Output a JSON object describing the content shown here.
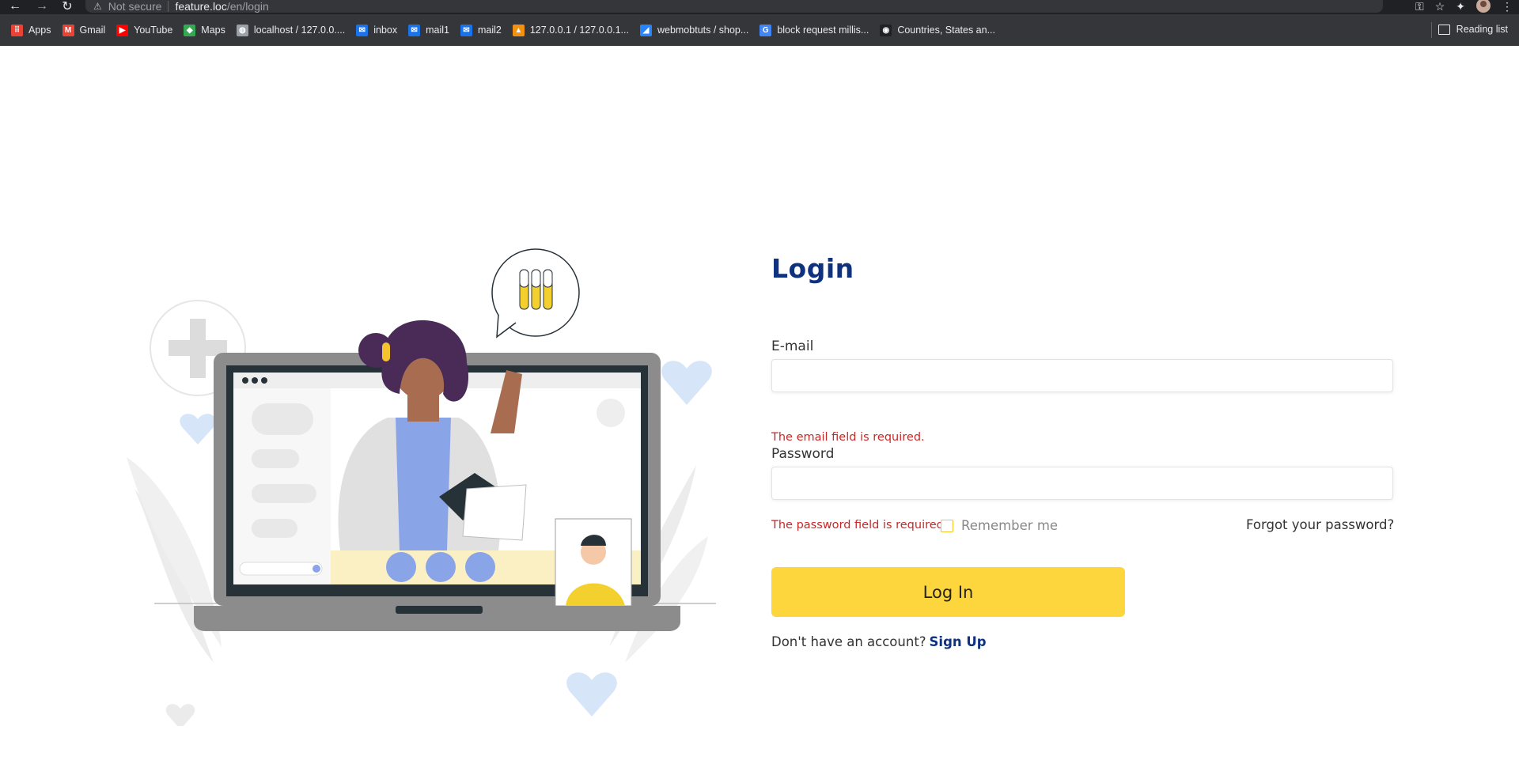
{
  "browser": {
    "omnibox": {
      "security_text": "Not secure",
      "host": "feature.loc",
      "path": "/en/login"
    },
    "bookmarks": [
      {
        "label": "Apps",
        "icon": "apps-grid-icon",
        "color": "#ea4335"
      },
      {
        "label": "Gmail",
        "icon": "gmail-icon",
        "color": "#ea4335"
      },
      {
        "label": "YouTube",
        "icon": "youtube-icon",
        "color": "#ff0000"
      },
      {
        "label": "Maps",
        "icon": "maps-icon",
        "color": "#34a853"
      },
      {
        "label": "localhost / 127.0.0....",
        "icon": "globe-icon",
        "color": "#9aa0a6"
      },
      {
        "label": "inbox",
        "icon": "mail-icon",
        "color": "#1a73e8"
      },
      {
        "label": "mail1",
        "icon": "mail-icon",
        "color": "#1a73e8"
      },
      {
        "label": "mail2",
        "icon": "mail-icon",
        "color": "#1a73e8"
      },
      {
        "label": "127.0.0.1 / 127.0.0.1...",
        "icon": "phpmyadmin-icon",
        "color": "#f29111"
      },
      {
        "label": "webmobtuts / shop...",
        "icon": "bitbucket-icon",
        "color": "#2684ff"
      },
      {
        "label": "block request millis...",
        "icon": "google-icon",
        "color": "#4285f4"
      },
      {
        "label": "Countries, States an...",
        "icon": "site-icon",
        "color": "#202124"
      }
    ],
    "reading_list": "Reading list"
  },
  "login": {
    "title": "Login",
    "email_label": "E-mail",
    "email_value": "",
    "email_error": "The email field is required.",
    "password_label": "Password",
    "password_value": "",
    "password_error": "The password field is required.",
    "remember_label": "Remember me",
    "forgot_label": "Forgot your password?",
    "submit_label": "Log In",
    "signup_prompt": "Don't have an account?",
    "signup_link": "Sign Up"
  },
  "colors": {
    "brand_blue": "#0f3280",
    "button_yellow": "#fdd53c",
    "error_red": "#c62828"
  }
}
